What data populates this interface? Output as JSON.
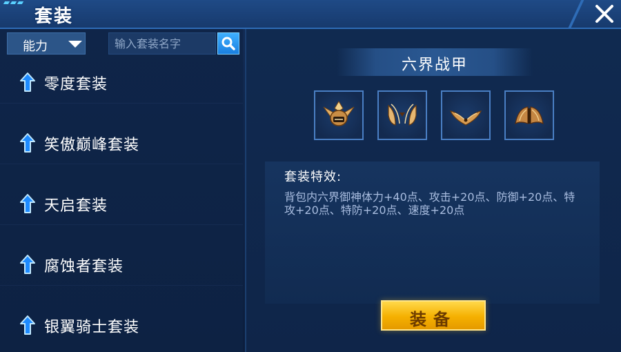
{
  "header": {
    "title": "套装"
  },
  "filter": {
    "label": "能力"
  },
  "search": {
    "placeholder": "输入套装名字"
  },
  "suits": [
    {
      "name": "零度套装"
    },
    {
      "name": "笑傲巅峰套装"
    },
    {
      "name": "天启套装"
    },
    {
      "name": "腐蚀者套装"
    },
    {
      "name": "银翼骑士套装"
    }
  ],
  "detail": {
    "set_name": "六界战甲",
    "slots": [
      {
        "icon": "helmet-icon"
      },
      {
        "icon": "shoulder-armor-icon"
      },
      {
        "icon": "chest-armor-icon"
      },
      {
        "icon": "wings-icon"
      }
    ],
    "effect_title": "套装特效:",
    "effect_text": "背包内六界御神体力+40点、攻击+20点、防御+20点、特攻+20点、特防+20点、速度+20点",
    "equip_label": "装备"
  },
  "colors": {
    "accent_blue": "#2e6cb7",
    "equip_button": "#f5b000",
    "effect_text": "#a9bde0"
  }
}
